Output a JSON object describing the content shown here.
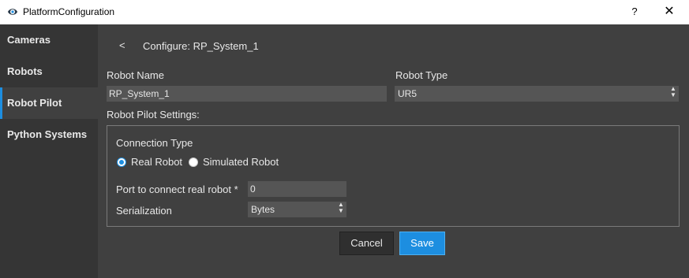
{
  "window": {
    "title": "PlatformConfiguration",
    "help_glyph": "?",
    "close_glyph": "✕",
    "icon": "app-eye-icon"
  },
  "sidebar": {
    "items": [
      {
        "label": "Cameras"
      },
      {
        "label": "Robots"
      },
      {
        "label": "Robot Pilot",
        "active": true
      },
      {
        "label": "Python Systems"
      }
    ]
  },
  "header": {
    "back_glyph": "<",
    "configure_label": "Configure:  RP_System_1"
  },
  "form": {
    "robot_name_label": "Robot Name",
    "robot_name_value": "RP_System_1",
    "robot_type_label": "Robot Type",
    "robot_type_value": "UR5",
    "settings_label": "Robot Pilot Settings:"
  },
  "settings": {
    "connection_type_label": "Connection Type",
    "real_robot_label": "Real Robot",
    "simulated_robot_label": "Simulated Robot",
    "selected": "Real Robot",
    "port_label": "Port to connect real robot *",
    "port_value": "0",
    "serialization_label": "Serialization",
    "serialization_value": "Bytes"
  },
  "buttons": {
    "cancel_label": "Cancel",
    "save_label": "Save"
  },
  "colors": {
    "accent": "#1d8ee0",
    "panel": "#404040",
    "sidebar": "#353535",
    "field": "#555555"
  }
}
